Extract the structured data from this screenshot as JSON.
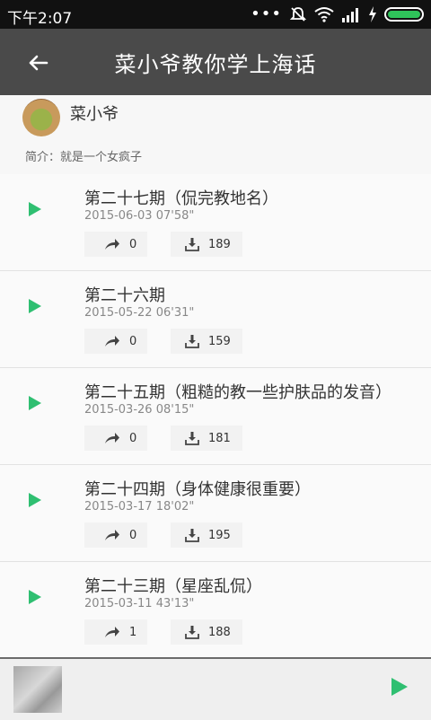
{
  "status_bar": {
    "time": "下午2:07",
    "more": "•••"
  },
  "app_bar": {
    "title": "菜小爷教你学上海话"
  },
  "profile": {
    "name": "菜小爷",
    "intro": "简介：就是一个女疯子"
  },
  "episodes": [
    {
      "title": "第二十七期（侃完教地名）",
      "date": "2015-06-03",
      "duration": "07'58\"",
      "shares": "0",
      "downloads": "189"
    },
    {
      "title": "第二十六期",
      "date": "2015-05-22",
      "duration": "06'31\"",
      "shares": "0",
      "downloads": "159"
    },
    {
      "title": "第二十五期（粗糙的教一些护肤品的发音）",
      "date": "2015-03-26",
      "duration": "08'15\"",
      "shares": "0",
      "downloads": "181"
    },
    {
      "title": "第二十四期（身体健康很重要）",
      "date": "2015-03-17",
      "duration": "18'02\"",
      "shares": "0",
      "downloads": "195"
    },
    {
      "title": "第二十三期（星座乱侃）",
      "date": "2015-03-11",
      "duration": "43'13\"",
      "shares": "1",
      "downloads": "188"
    }
  ],
  "icons": {
    "back": "arrow-left-icon",
    "play": "play-icon",
    "share": "share-icon",
    "download": "download-icon",
    "wifi": "wifi-icon",
    "signal": "signal-icon",
    "mute": "mute-icon",
    "battery": "battery-icon"
  },
  "colors": {
    "accent_green": "#2fbf71",
    "app_bar": "#4a4a4a",
    "status_bar": "#111111"
  }
}
